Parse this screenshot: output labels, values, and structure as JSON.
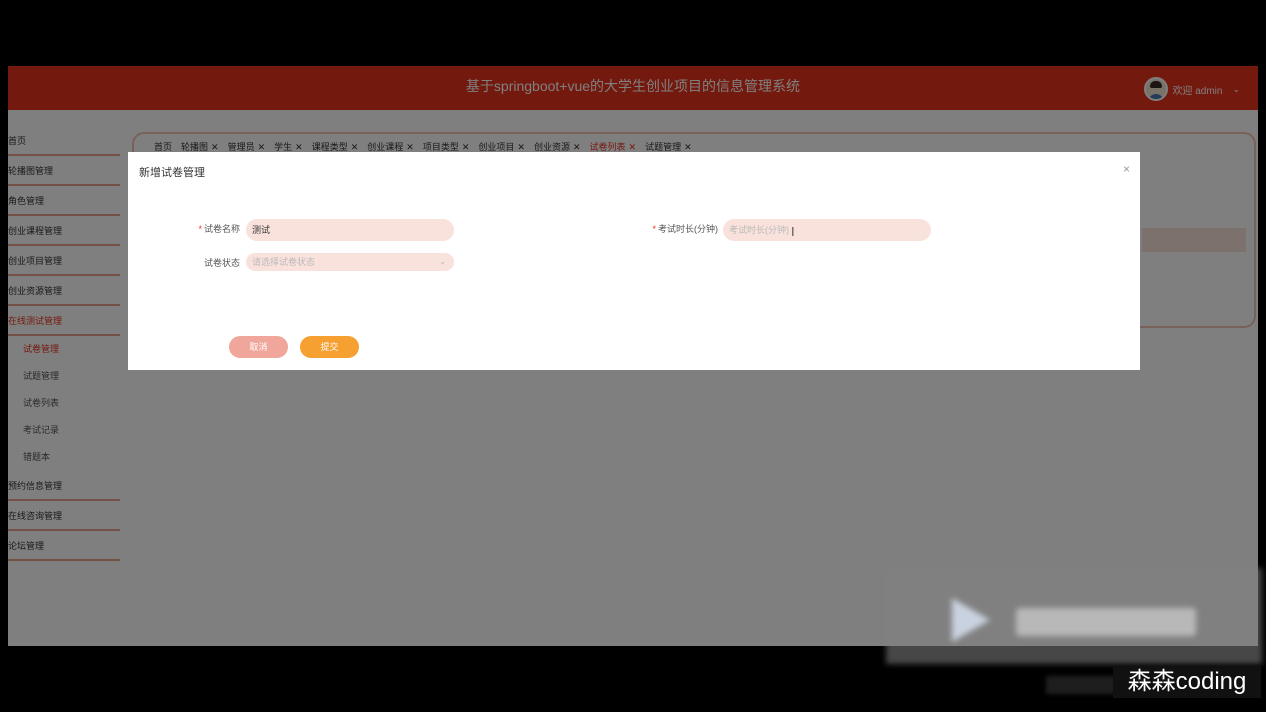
{
  "app": {
    "title": "基于springboot+vue的大学生创业项目的信息管理系统",
    "user_greeting": "欢迎 admin",
    "user_menu_icon": "chevron-down-icon"
  },
  "sidebar": {
    "items": [
      {
        "label": "首页"
      },
      {
        "label": "轮播图管理"
      },
      {
        "label": "角色管理"
      },
      {
        "label": "创业课程管理"
      },
      {
        "label": "创业项目管理"
      },
      {
        "label": "创业资源管理"
      },
      {
        "label": "在线测试管理"
      }
    ],
    "sub_items": [
      {
        "label": "试卷管理"
      },
      {
        "label": "试题管理"
      },
      {
        "label": "试卷列表"
      },
      {
        "label": "考试记录"
      },
      {
        "label": "错题本"
      }
    ],
    "bottom_items": [
      {
        "label": "预约信息管理"
      },
      {
        "label": "在线咨询管理"
      },
      {
        "label": "论坛管理"
      }
    ]
  },
  "tabs": [
    {
      "label": "首页"
    },
    {
      "label": "轮播图"
    },
    {
      "label": "管理员"
    },
    {
      "label": "学生"
    },
    {
      "label": "课程类型"
    },
    {
      "label": "创业课程"
    },
    {
      "label": "项目类型"
    },
    {
      "label": "创业项目"
    },
    {
      "label": "创业资源"
    },
    {
      "label": "试卷列表"
    },
    {
      "label": "试题管理"
    }
  ],
  "dialog": {
    "title": "新增试卷管理",
    "close_icon": "close-icon",
    "fields": {
      "name": {
        "label": "试卷名称",
        "value": "测试"
      },
      "duration": {
        "label": "考试时长(分钟)",
        "placeholder": "考试时长(分钟)"
      },
      "status": {
        "label": "试卷状态",
        "placeholder": "请选择试卷状态"
      }
    },
    "buttons": {
      "cancel": "取消",
      "submit": "提交"
    }
  },
  "watermark": "森森coding",
  "colors": {
    "brand": "#e8321c",
    "submit": "#f7a032",
    "cancel": "#f0a69a",
    "input_bg": "#f9e1dc"
  }
}
